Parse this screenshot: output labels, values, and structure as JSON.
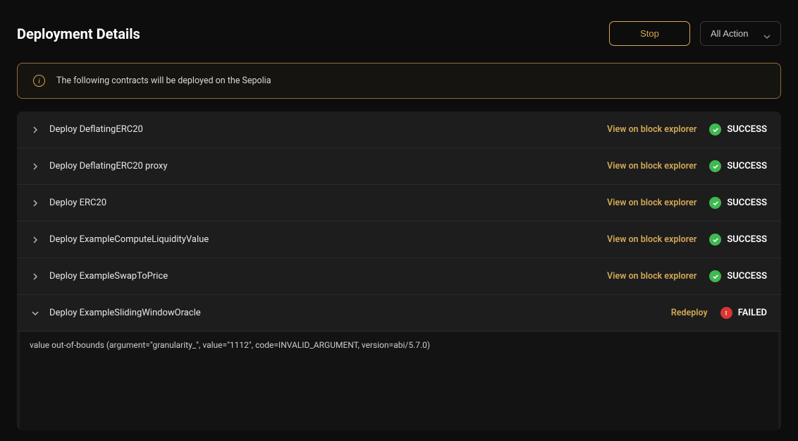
{
  "header": {
    "title": "Deployment Details",
    "stop_label": "Stop",
    "action_label": "All Action"
  },
  "banner": {
    "text": "The following contracts will be deployed on the Sepolia"
  },
  "deploy": {
    "view_link": "View on block explorer",
    "redeploy_link": "Redeploy",
    "status_success": "SUCCESS",
    "status_failed": "FAILED",
    "items": [
      {
        "label": "Deploy DeflatingERC20"
      },
      {
        "label": "Deploy DeflatingERC20 proxy"
      },
      {
        "label": "Deploy ERC20"
      },
      {
        "label": "Deploy ExampleComputeLiquidityValue"
      },
      {
        "label": "Deploy ExampleSwapToPrice"
      },
      {
        "label": "Deploy ExampleSlidingWindowOracle"
      }
    ]
  },
  "error": {
    "message": "value out-of-bounds (argument=\"granularity_\", value=\"1112\", code=INVALID_ARGUMENT, version=abi/5.7.0)"
  }
}
